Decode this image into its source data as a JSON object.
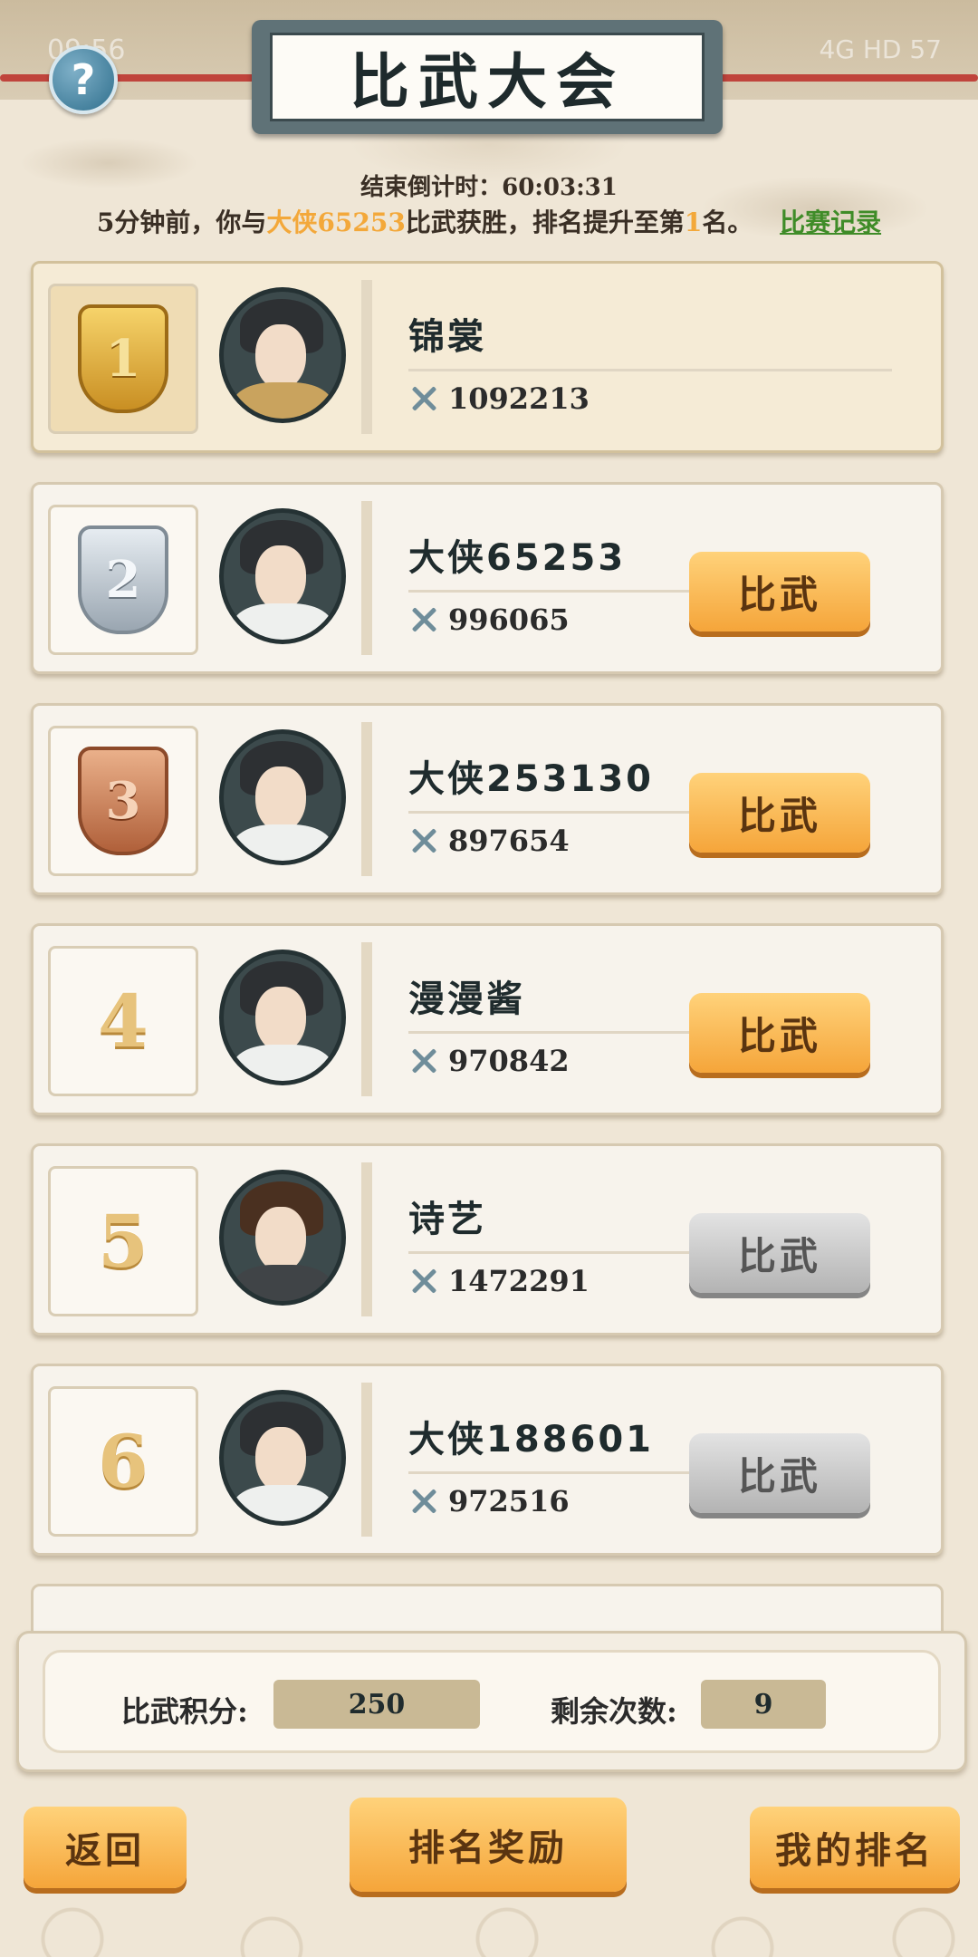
{
  "status_bar": {
    "time": "09:56",
    "right": "4G HD 57"
  },
  "header": {
    "title": "比武大会",
    "help_label": "?"
  },
  "countdown": "结束倒计时：60:03:31",
  "notice": {
    "prefix": "5分钟前，你与",
    "opponent": "大侠65253",
    "middle": "比武获胜，排名提升至第",
    "rank": "1",
    "suffix": "名。",
    "record_link": "比赛记录"
  },
  "players": [
    {
      "rank": "1",
      "name": "锦裳",
      "power": "1092213",
      "button": "",
      "medal": "gold"
    },
    {
      "rank": "2",
      "name": "大侠65253",
      "power": "996065",
      "button": "比武",
      "medal": "silver"
    },
    {
      "rank": "3",
      "name": "大侠253130",
      "power": "897654",
      "button": "比武",
      "medal": "bronze"
    },
    {
      "rank": "4",
      "name": "漫漫酱",
      "power": "970842",
      "button": "比武",
      "medal": ""
    },
    {
      "rank": "5",
      "name": "诗艺",
      "power": "1472291",
      "button": "比武",
      "medal": ""
    },
    {
      "rank": "6",
      "name": "大侠188601",
      "power": "972516",
      "button": "比武",
      "medal": ""
    }
  ],
  "stats": {
    "score_label": "比武积分:",
    "score_value": "250",
    "remaining_label": "剩余次数:",
    "remaining_value": "9"
  },
  "bottom": {
    "back": "返回",
    "rewards": "排名奖励",
    "my_rank": "我的排名"
  },
  "colors": {
    "accent_orange": "#f5a53a",
    "highlight": "#f3a83a",
    "link_green": "#3f8c28"
  }
}
